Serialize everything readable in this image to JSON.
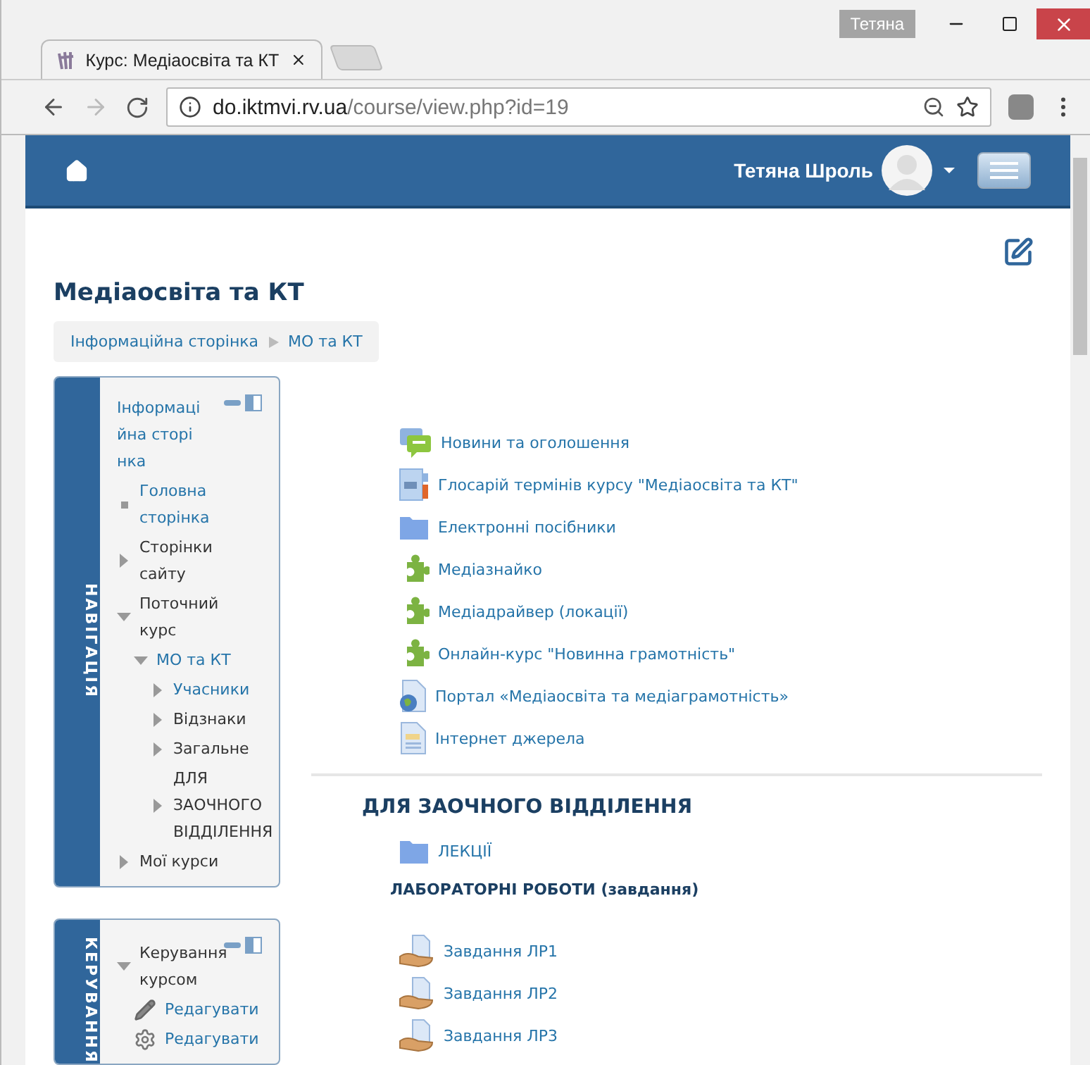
{
  "browser": {
    "profile": "Тетяна",
    "tab_title": "Курс: Медіаосвіта та КТ",
    "url_host": "do.iktmvi.rv.ua",
    "url_path": "/course/view.php?id=19"
  },
  "navbar": {
    "user_name": "Тетяна Шроль"
  },
  "course_title": "Медіаосвіта та КТ",
  "breadcrumb": [
    "Інформаційна сторінка",
    "МО та КТ"
  ],
  "navigation": {
    "title": "НАВІГАЦІЯ",
    "top": "Інформаційна сторінка",
    "items": [
      {
        "label": "Головна сторінка",
        "kind": "leaf",
        "link": true
      },
      {
        "label": "Сторінки сайту",
        "kind": "branch",
        "expanded": false,
        "link": false
      },
      {
        "label": "Поточний курс",
        "kind": "branch",
        "expanded": true,
        "link": false,
        "children": [
          {
            "label": "МО та КТ",
            "kind": "branch",
            "expanded": true,
            "link": true,
            "children": [
              {
                "label": "Учасники",
                "kind": "branch",
                "expanded": false,
                "link": true
              },
              {
                "label": "Відзнаки",
                "kind": "branch",
                "expanded": false,
                "link": false
              },
              {
                "label": "Загальне",
                "kind": "branch",
                "expanded": false,
                "link": false
              },
              {
                "label": "ДЛЯ ЗАОЧНОГО ВІДДІЛЕННЯ",
                "kind": "branch",
                "expanded": false,
                "link": false
              }
            ]
          }
        ]
      },
      {
        "label": "Мої курси",
        "kind": "branch",
        "expanded": false,
        "link": false
      }
    ]
  },
  "administration": {
    "title": "КЕРУВАННЯ",
    "items": [
      {
        "label": "Керування курсом",
        "kind": "branch",
        "expanded": true,
        "link": false,
        "children": [
          {
            "label": "Редагувати",
            "kind": "pencil",
            "link": true
          },
          {
            "label": "Редагувати",
            "kind": "gear",
            "link": true
          }
        ]
      }
    ]
  },
  "section_general": {
    "activities": [
      {
        "label": "Новини та оголошення",
        "kind": "forum"
      },
      {
        "label": "Глосарій термінів курсу \"Медіаосвіта та КТ\"",
        "kind": "glossary"
      },
      {
        "label": "Електронні посібники",
        "kind": "folder"
      },
      {
        "label": "Медіазнайко",
        "kind": "puzzle"
      },
      {
        "label": "Медіадрайвер (локації)",
        "kind": "puzzle"
      },
      {
        "label": "Онлайн-курс \"Новинна грамотність\"",
        "kind": "puzzle"
      },
      {
        "label": "Портал «Медіаосвіта та медіаграмотність»",
        "kind": "url"
      },
      {
        "label": "Інтернет джерела",
        "kind": "page"
      }
    ]
  },
  "section_extramural": {
    "heading": "ДЛЯ ЗАОЧНОГО ВІДДІЛЕННЯ",
    "activities": [
      {
        "label": "ЛЕКЦІЇ",
        "kind": "folder"
      },
      {
        "label": "ЛАБОРАТОРНІ РОБОТИ (завдання)",
        "kind": "label"
      },
      {
        "label": "Завдання ЛР1",
        "kind": "assign"
      },
      {
        "label": "Завдання ЛР2",
        "kind": "assign"
      },
      {
        "label": "Завдання ЛР3",
        "kind": "assign"
      }
    ]
  }
}
